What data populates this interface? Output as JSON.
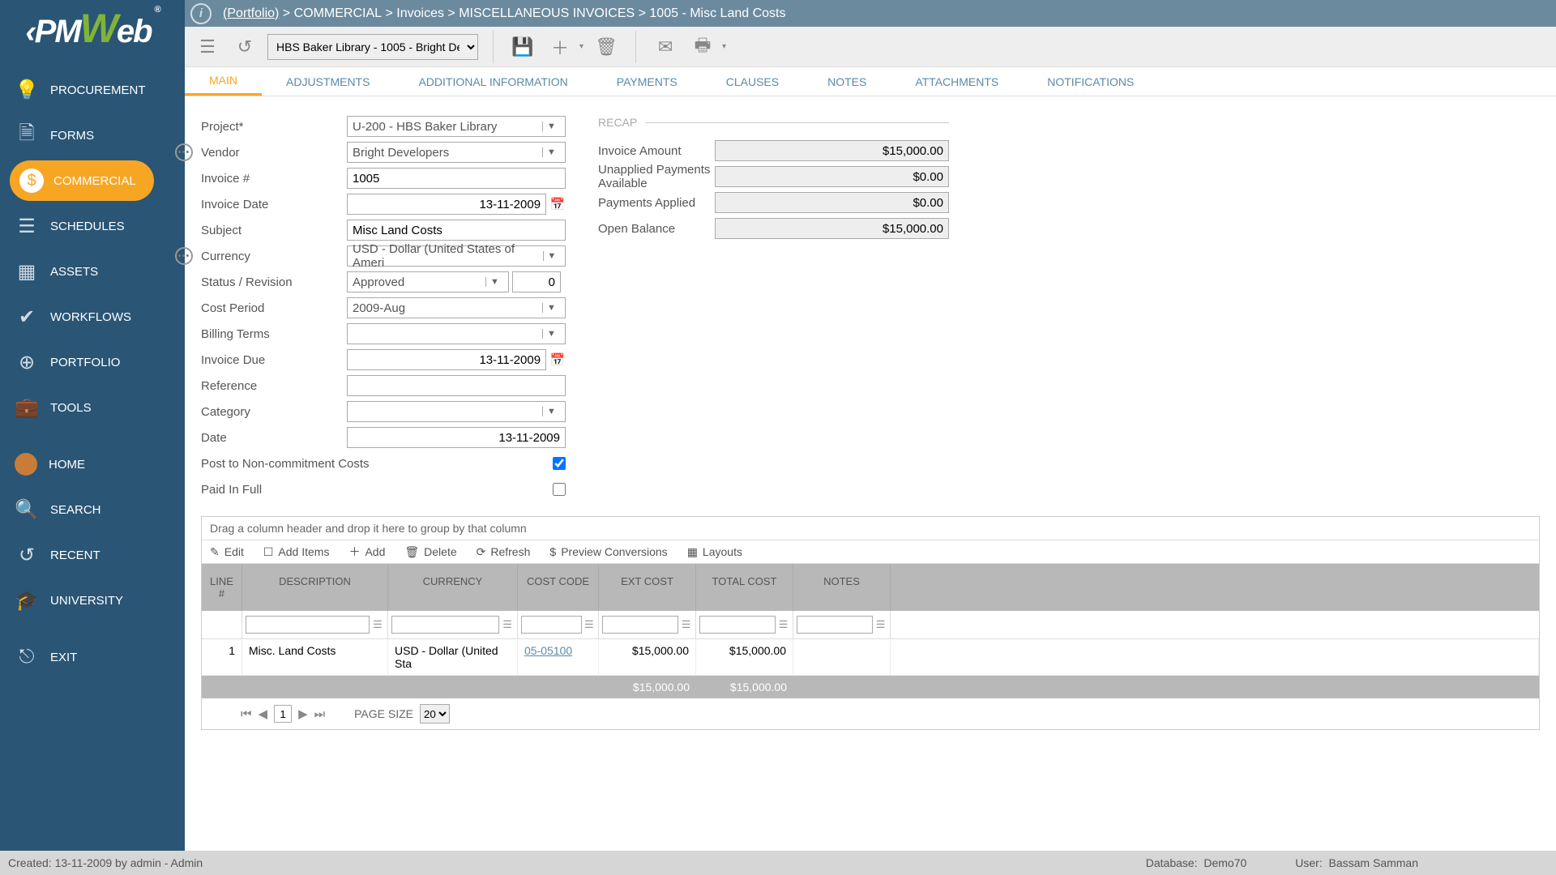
{
  "breadcrumb": {
    "portfolio": "(Portfolio)",
    "commercial": "COMMERCIAL",
    "invoices": "Invoices",
    "misc": "MISCELLANEOUS INVOICES",
    "item": "1005 - Misc Land Costs"
  },
  "toolbar": {
    "selector": "HBS Baker Library - 1005 - Bright De"
  },
  "nav": {
    "procurement": "PROCUREMENT",
    "forms": "FORMS",
    "commercial": "COMMERCIAL",
    "schedules": "SCHEDULES",
    "assets": "ASSETS",
    "workflows": "WORKFLOWS",
    "portfolio": "PORTFOLIO",
    "tools": "TOOLS",
    "home": "HOME",
    "search": "SEARCH",
    "recent": "RECENT",
    "university": "UNIVERSITY",
    "exit": "EXIT"
  },
  "tabs": {
    "main": "MAIN",
    "adjustments": "ADJUSTMENTS",
    "additional": "ADDITIONAL INFORMATION",
    "payments": "PAYMENTS",
    "clauses": "CLAUSES",
    "notes": "NOTES",
    "attachments": "ATTACHMENTS",
    "notifications": "NOTIFICATIONS"
  },
  "form": {
    "labels": {
      "project": "Project*",
      "vendor": "Vendor",
      "invoice_no": "Invoice #",
      "invoice_date": "Invoice Date",
      "subject": "Subject",
      "currency": "Currency",
      "status": "Status / Revision",
      "cost_period": "Cost Period",
      "billing_terms": "Billing Terms",
      "invoice_due": "Invoice Due",
      "reference": "Reference",
      "category": "Category",
      "date": "Date",
      "post": "Post to Non-commitment Costs",
      "paid": "Paid In Full"
    },
    "values": {
      "project": "U-200 - HBS Baker Library",
      "vendor": "Bright Developers",
      "invoice_no": "1005",
      "invoice_date": "13-11-2009",
      "subject": "Misc Land Costs",
      "currency": "USD - Dollar (United States of Ameri",
      "status": "Approved",
      "revision": "0",
      "cost_period": "2009-Aug",
      "billing_terms": "",
      "invoice_due": "13-11-2009",
      "reference": "",
      "category": "",
      "date": "13-11-2009"
    }
  },
  "recap": {
    "title": "RECAP",
    "labels": {
      "invoice_amount": "Invoice Amount",
      "unapplied": "Unapplied Payments Available",
      "payments_applied": "Payments Applied",
      "open_balance": "Open Balance"
    },
    "values": {
      "invoice_amount": "$15,000.00",
      "unapplied": "$0.00",
      "payments_applied": "$0.00",
      "open_balance": "$15,000.00"
    }
  },
  "grid": {
    "group_hint": "Drag a column header and drop it here to group by that column",
    "buttons": {
      "edit": "Edit",
      "add_items": "Add Items",
      "add": "Add",
      "delete": "Delete",
      "refresh": "Refresh",
      "preview": "Preview Conversions",
      "layouts": "Layouts"
    },
    "headers": {
      "line": "LINE #",
      "desc": "DESCRIPTION",
      "currency": "CURRENCY",
      "cost_code": "COST CODE",
      "ext_cost": "EXT COST",
      "total_cost": "TOTAL COST",
      "notes": "NOTES"
    },
    "row": {
      "line": "1",
      "desc": "Misc. Land Costs",
      "currency": "USD - Dollar (United Sta",
      "cost_code": "05-05100",
      "ext_cost": "$15,000.00",
      "total_cost": "$15,000.00",
      "notes": ""
    },
    "totals": {
      "ext_cost": "$15,000.00",
      "total_cost": "$15,000.00"
    },
    "pager": {
      "page": "1",
      "page_size_label": "PAGE SIZE",
      "page_size": "20"
    }
  },
  "footer": {
    "created": "Created:  13-11-2009 by admin - Admin",
    "database_label": "Database:",
    "database": "Demo70",
    "user_label": "User:",
    "user": "Bassam Samman"
  }
}
